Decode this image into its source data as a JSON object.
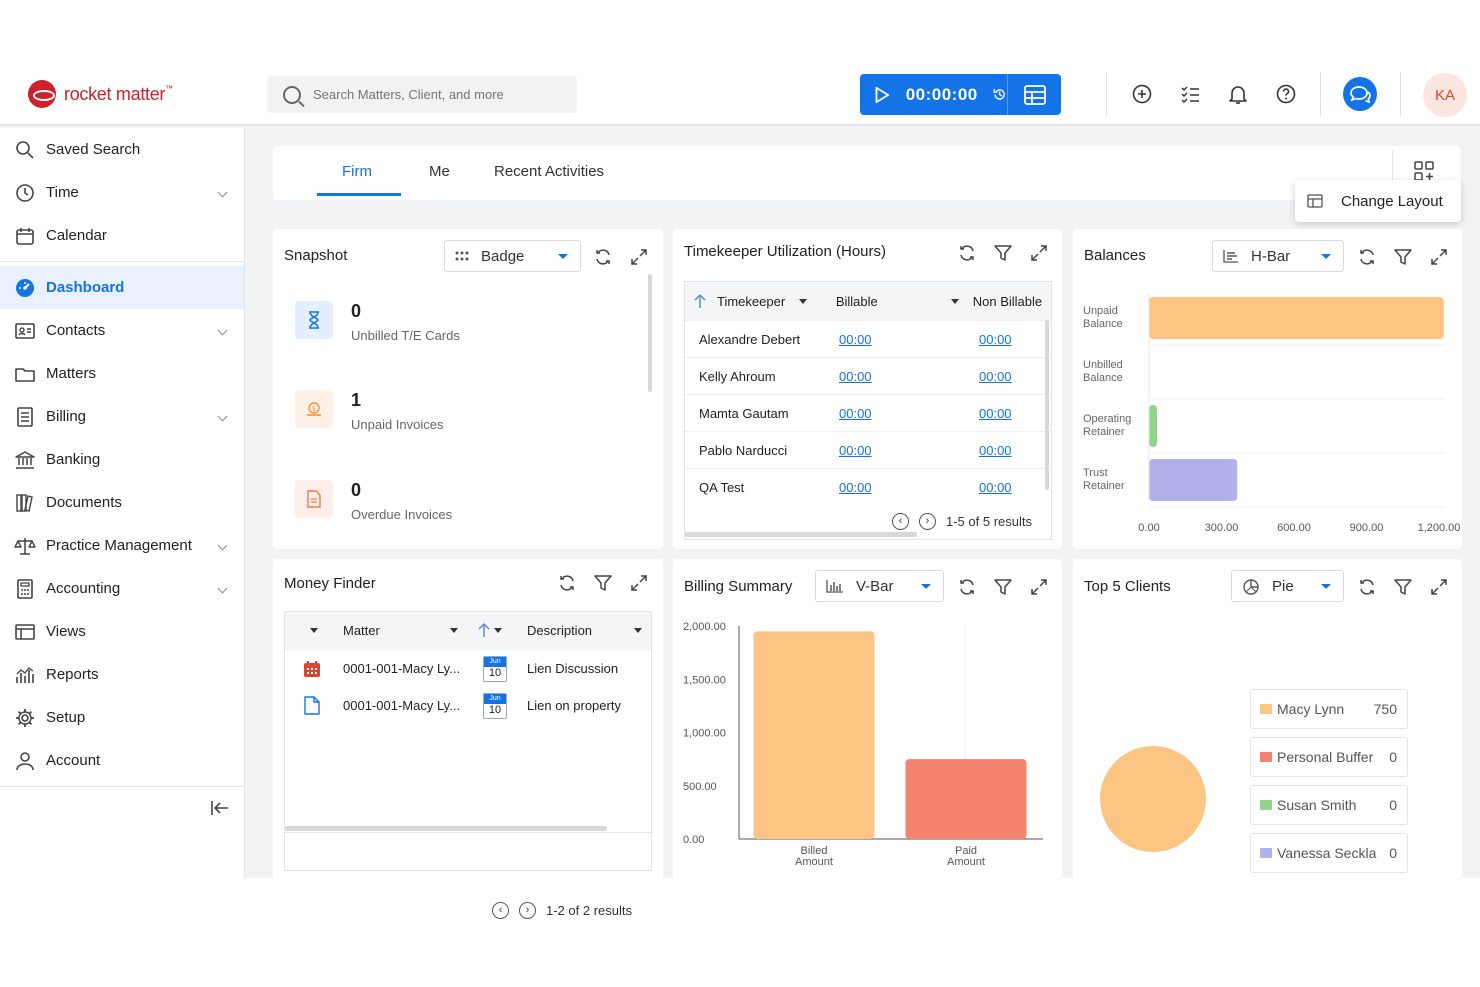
{
  "brand": {
    "name": "rocket matter",
    "tm": "™"
  },
  "search": {
    "placeholder": "Search Matters, Client, and more"
  },
  "timer": {
    "value": "00:00:00"
  },
  "user": {
    "initials": "KA"
  },
  "colors": {
    "accent": "#1473e6",
    "orange": "#fdc584",
    "red": "#f4846f",
    "green": "#8fd68a",
    "purple": "#b3b1ec"
  },
  "sidebar": {
    "items": [
      {
        "label": "Saved Search",
        "icon": "search-icon"
      },
      {
        "label": "Time",
        "icon": "clock-icon"
      },
      {
        "label": "Calendar",
        "icon": "calendar-icon"
      },
      {
        "label": "Dashboard",
        "icon": "dashboard-icon",
        "active": true
      },
      {
        "label": "Contacts",
        "icon": "contacts-icon"
      },
      {
        "label": "Matters",
        "icon": "folder-icon"
      },
      {
        "label": "Billing",
        "icon": "billing-icon"
      },
      {
        "label": "Banking",
        "icon": "bank-icon"
      },
      {
        "label": "Documents",
        "icon": "documents-icon"
      },
      {
        "label": "Practice Management",
        "icon": "scale-icon"
      },
      {
        "label": "Accounting",
        "icon": "accounting-icon"
      },
      {
        "label": "Views",
        "icon": "views-icon"
      },
      {
        "label": "Reports",
        "icon": "reports-icon"
      },
      {
        "label": "Setup",
        "icon": "gear-icon"
      },
      {
        "label": "Account",
        "icon": "user-icon"
      }
    ]
  },
  "tabs": [
    "Firm",
    "Me",
    "Recent Activities"
  ],
  "change_layout": "Change Layout",
  "snapshot": {
    "title": "Snapshot",
    "view": "Badge",
    "items": [
      {
        "value": "0",
        "label": "Unbilled T/E Cards"
      },
      {
        "value": "1",
        "label": "Unpaid Invoices"
      },
      {
        "value": "0",
        "label": "Overdue Invoices"
      }
    ]
  },
  "timekeeper": {
    "title": "Timekeeper Utilization (Hours)",
    "columns": [
      "Timekeeper",
      "Billable",
      "Non Billable"
    ],
    "rows": [
      {
        "name": "Alexandre Debert",
        "billable": "00:00",
        "non": "00:00"
      },
      {
        "name": "Kelly Ahroum",
        "billable": "00:00",
        "non": "00:00"
      },
      {
        "name": "Mamta Gautam",
        "billable": "00:00",
        "non": "00:00"
      },
      {
        "name": "Pablo Narducci",
        "billable": "00:00",
        "non": "00:00"
      },
      {
        "name": "QA Test",
        "billable": "00:00",
        "non": "00:00"
      }
    ],
    "pager": "1-5 of 5 results"
  },
  "balances": {
    "title": "Balances",
    "view": "H-Bar"
  },
  "money_finder": {
    "title": "Money Finder",
    "columns": [
      "Matter",
      "Description"
    ],
    "rows": [
      {
        "matter": "0001-001-Macy Ly...",
        "month": "Jun",
        "day": "10",
        "desc": "Lien Discussion"
      },
      {
        "matter": "0001-001-Macy Ly...",
        "month": "Jun",
        "day": "10",
        "desc": "Lien on property"
      }
    ],
    "pager": "1-2 of 2 results"
  },
  "billing_summary": {
    "title": "Billing Summary",
    "view": "V-Bar"
  },
  "top_clients": {
    "title": "Top 5 Clients",
    "view": "Pie"
  },
  "chart_data": [
    {
      "type": "bar",
      "orientation": "horizontal",
      "categories": [
        "Unpaid Balance",
        "Unbilled Balance",
        "Operating Retainer",
        "Trust Retainer"
      ],
      "values": [
        1220,
        0,
        25,
        365
      ],
      "xticks": [
        "0.00",
        "300.00",
        "600.00",
        "900.00",
        "1,200.00"
      ],
      "xlim": [
        0,
        1200
      ],
      "colors": [
        "#fdc584",
        "#fdc584",
        "#8fd68a",
        "#b3b1ec"
      ]
    },
    {
      "type": "bar",
      "orientation": "vertical",
      "categories": [
        "Billed Amount",
        "Paid Amount"
      ],
      "values": [
        1950,
        750
      ],
      "yticks": [
        "2,000.00",
        "1,500.00",
        "1,000.00",
        "500.00",
        "0.00"
      ],
      "ylim": [
        0,
        2000
      ],
      "colors": [
        "#fdc584",
        "#f4846f"
      ]
    },
    {
      "type": "pie",
      "categories": [
        "Macy Lynn",
        "Personal Buffer",
        "Susan Smith",
        "Vanessa Seckla"
      ],
      "values": [
        750,
        0,
        0,
        0
      ],
      "colors": [
        "#fdc584",
        "#f4846f",
        "#8fd68a",
        "#b3b1ec"
      ]
    }
  ]
}
